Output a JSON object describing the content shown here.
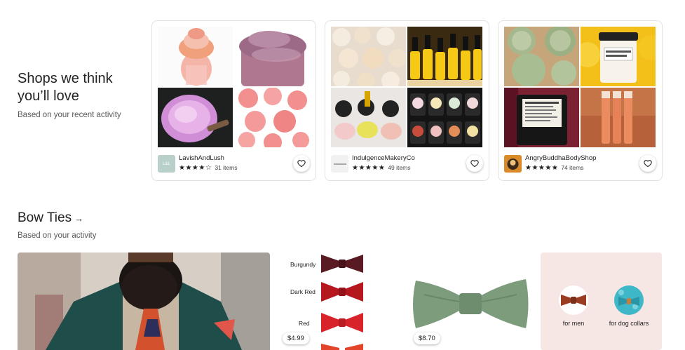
{
  "shops_section": {
    "title": "Shops we think you’ll love",
    "subtitle": "Based on your recent activity"
  },
  "shops": [
    {
      "name": "LavishAndLush",
      "stars": "★★★★☆",
      "items": "31 items",
      "avatar_text": "L&L",
      "avatar_icon": "lavish-avatar"
    },
    {
      "name": "IndulgenceMakeryCo",
      "stars": "★★★★★",
      "items": "49 items",
      "avatar_text": "",
      "avatar_icon": "indulgence-avatar"
    },
    {
      "name": "AngryBuddhaBodyShop",
      "stars": "★★★★★",
      "items": "74 items",
      "avatar_text": "",
      "avatar_icon": "buddha-avatar"
    }
  ],
  "bow_section": {
    "title": "Bow Ties",
    "arrow": "→",
    "subtitle": "Based on your activity"
  },
  "bow_products": [
    {
      "price": "$4.99",
      "colors": [
        "Burgundy",
        "Dark Red",
        "Red"
      ]
    },
    {
      "price": "$8.70"
    }
  ],
  "bow_categories": [
    {
      "label": "for men"
    },
    {
      "label": "for dog collars"
    }
  ],
  "colors": {
    "accent_pink": "#f7e7e4",
    "star": "#222222"
  }
}
